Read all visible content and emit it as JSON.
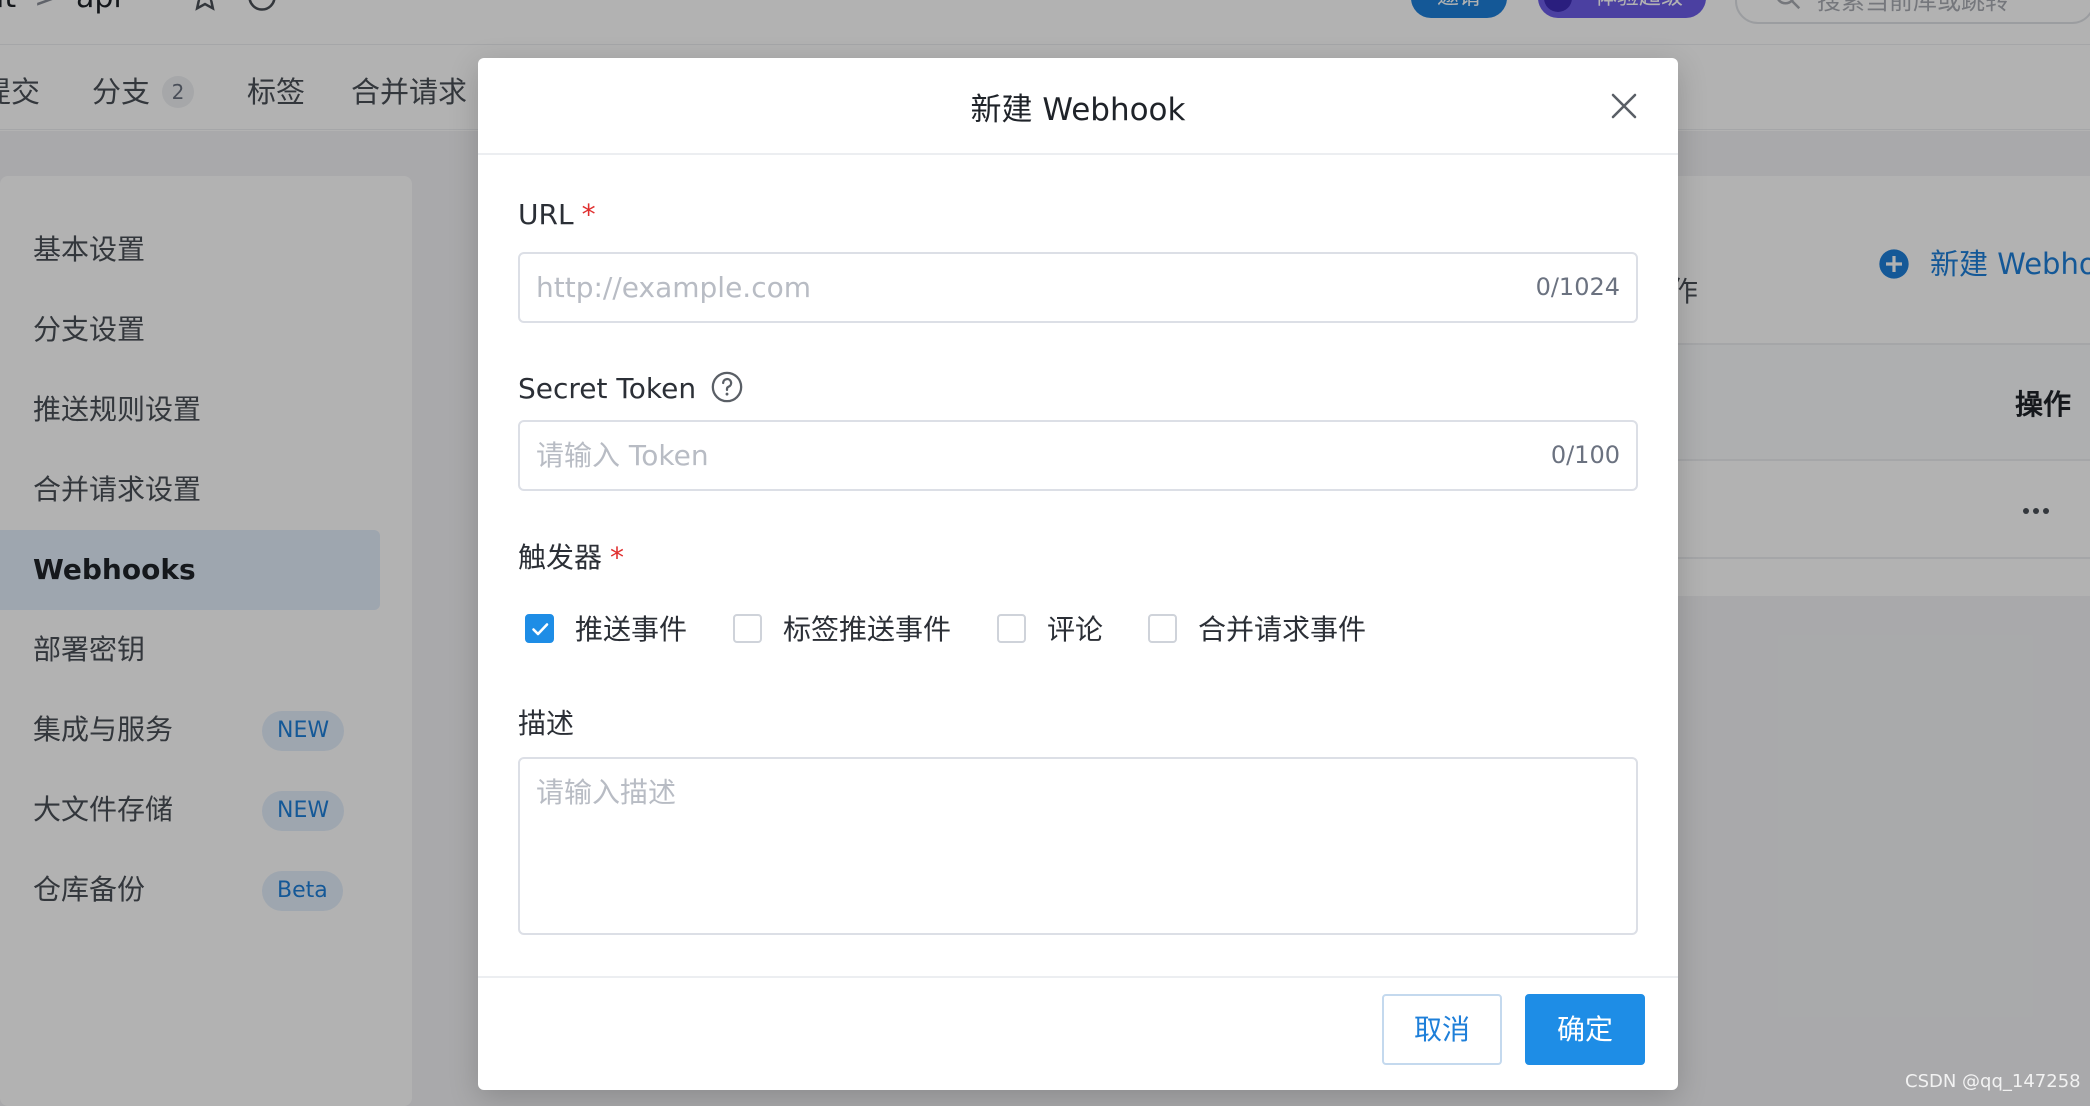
{
  "app": {
    "breadcrumb": [
      {
        "text": "it"
      },
      {
        "text": ">"
      },
      {
        "text": "api"
      }
    ],
    "invite_label": "邀请",
    "trial_label": "体验超级",
    "search": {
      "placeholder": "搜索当前库或跳转"
    }
  },
  "repo_nav": {
    "tabs": [
      {
        "label": "提交"
      },
      {
        "label": "分支",
        "count": "2"
      },
      {
        "label": "标签"
      },
      {
        "label": "合并请求"
      }
    ]
  },
  "sidebar": {
    "items": [
      {
        "label": "基本设置"
      },
      {
        "label": "分支设置"
      },
      {
        "label": "推送规则设置"
      },
      {
        "label": "合并请求设置"
      },
      {
        "label": "Webhooks",
        "active": true
      },
      {
        "label": "部署密钥"
      },
      {
        "label": "集成与服务",
        "tag": "NEW"
      },
      {
        "label": "大文件存储",
        "tag": "NEW"
      },
      {
        "label": "仓库备份",
        "tag": "Beta"
      }
    ]
  },
  "webhook_panel": {
    "partial_text": "作",
    "new_link": "新建 Webhook",
    "table_header_ops": "操作",
    "row_more_icon": "more-icon"
  },
  "modal": {
    "title": "新建 Webhook",
    "url": {
      "label": "URL",
      "required_mark": "*",
      "placeholder": "http://example.com",
      "value": "",
      "counter": "0/1024"
    },
    "secret": {
      "label": "Secret Token",
      "placeholder": "请输入 Token",
      "value": "",
      "counter": "0/100",
      "help_icon": "question-circle-icon"
    },
    "triggers": {
      "label": "触发器",
      "required_mark": "*",
      "options": [
        {
          "label": "推送事件",
          "checked": true
        },
        {
          "label": "标签推送事件",
          "checked": false
        },
        {
          "label": "评论",
          "checked": false
        },
        {
          "label": "合并请求事件",
          "checked": false
        }
      ]
    },
    "description": {
      "label": "描述",
      "placeholder": "请输入描述",
      "value": ""
    },
    "buttons": {
      "cancel": "取消",
      "ok": "确定"
    }
  },
  "watermark": "CSDN @qq_147258",
  "colors": {
    "accent": "#1e8de6",
    "link": "#1e7fd9",
    "required": "#e02f2f",
    "overlay": "rgba(0,0,0,0.30)"
  }
}
